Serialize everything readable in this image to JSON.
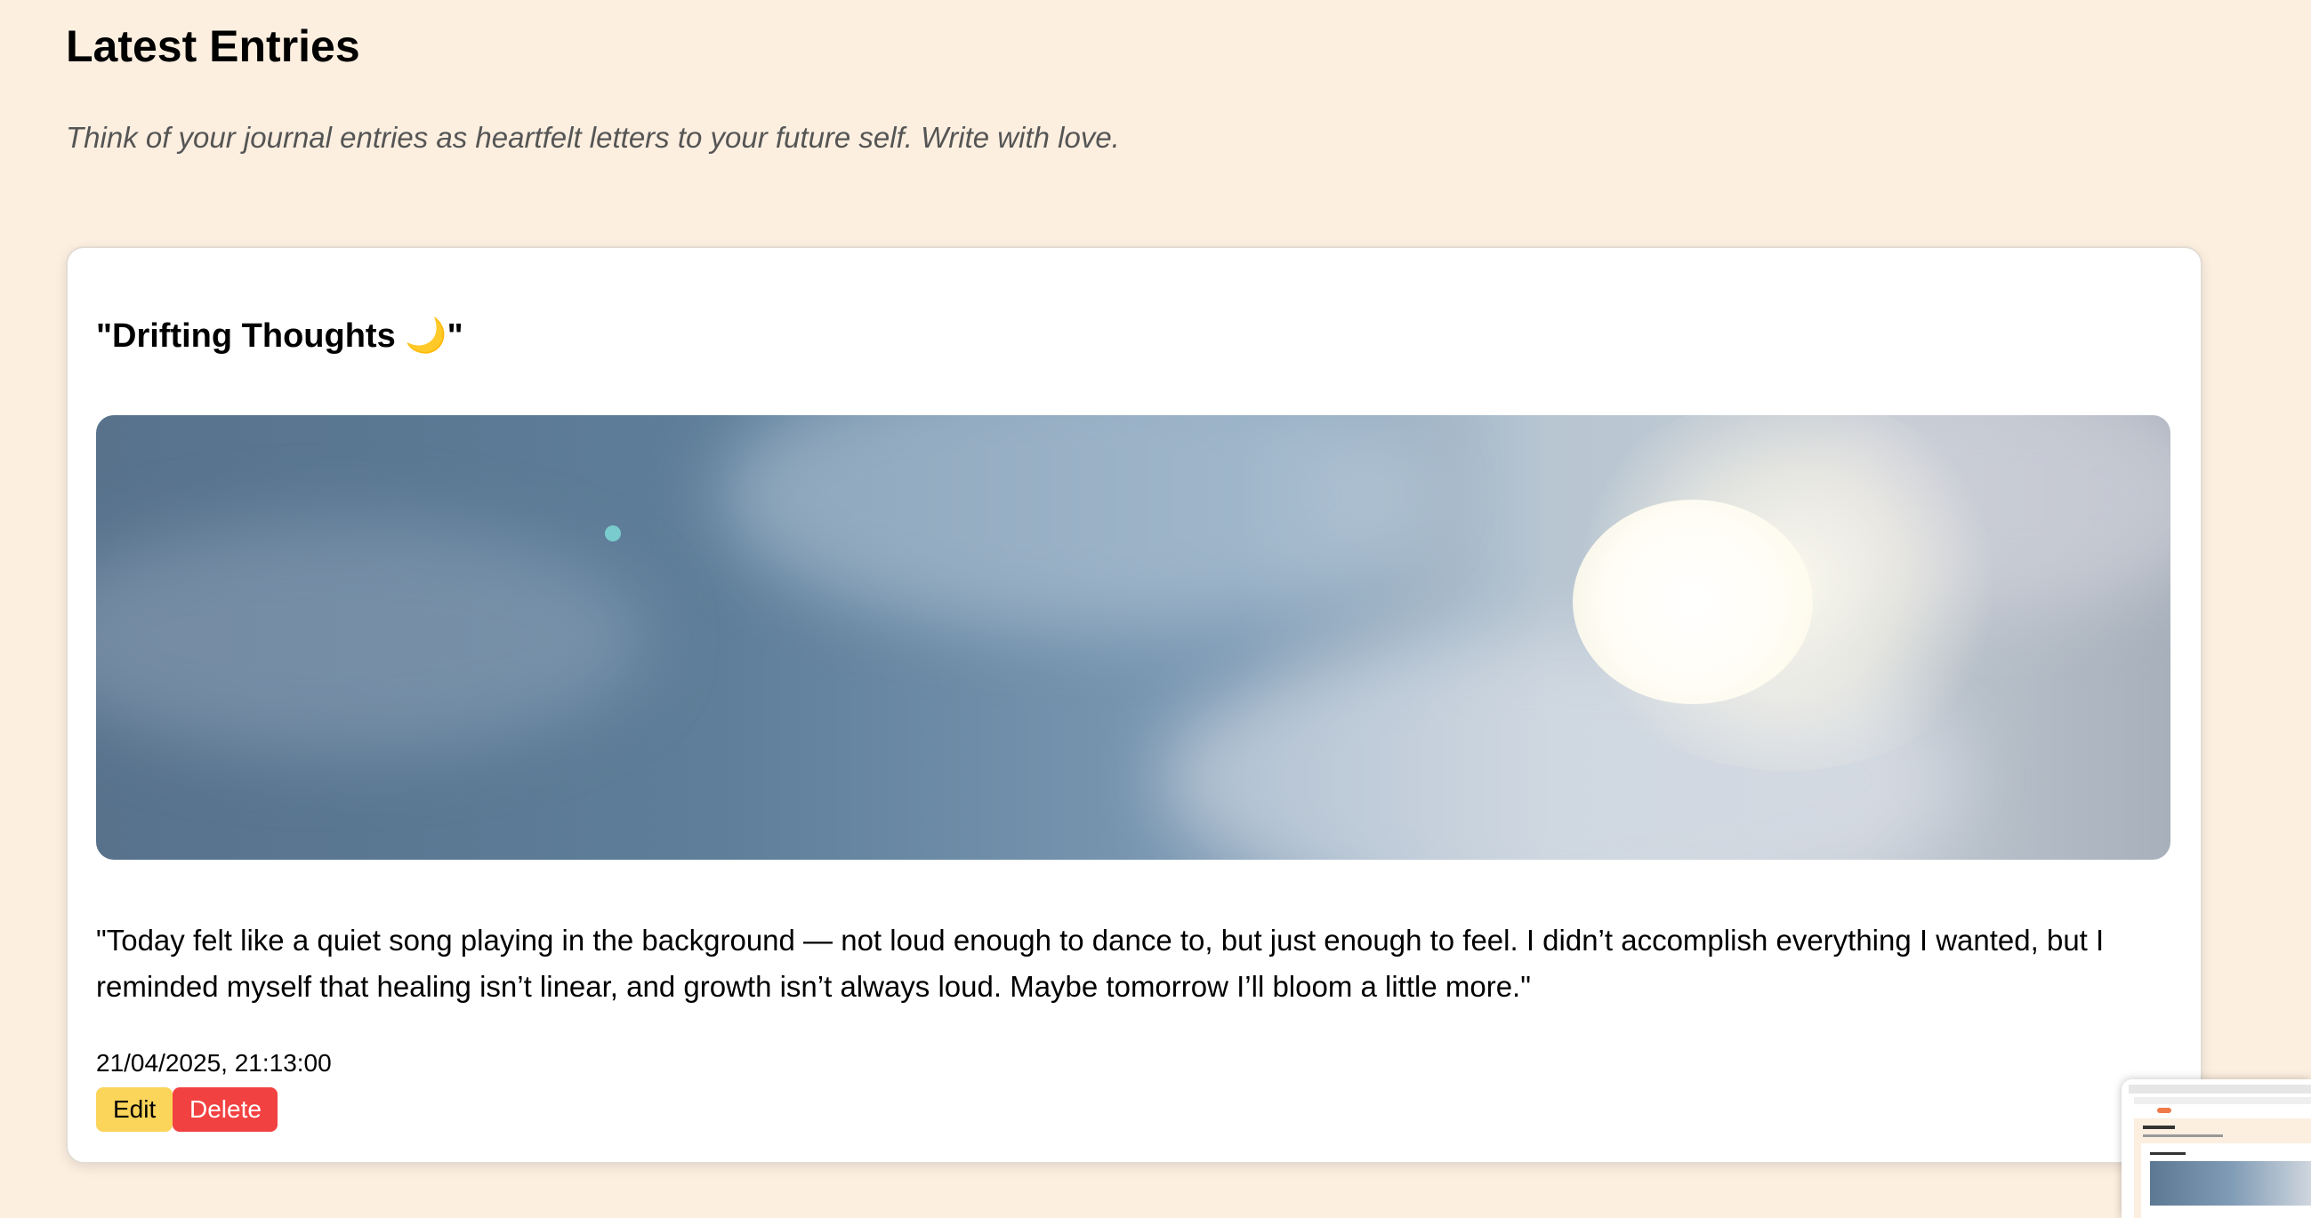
{
  "page": {
    "title": "Latest Entries",
    "subtitle": "Think of your journal entries as heartfelt letters to your future self. Write with love."
  },
  "entry": {
    "title": "\"Drifting Thoughts 🌙\"",
    "image_alt": "cloudy sky with bright sun",
    "text": "\"Today felt like a quiet song playing in the background — not loud enough to dance to, but just enough to feel. I didn’t accomplish everything I wanted, but I reminded myself that healing isn’t linear, and growth isn’t always loud. Maybe tomorrow I’ll bloom a little more.\"",
    "date": "21/04/2025, 21:13:00",
    "edit_label": "Edit",
    "delete_label": "Delete"
  },
  "colors": {
    "background": "#fcefe0",
    "edit_button": "#fbd45a",
    "delete_button": "#f24141"
  }
}
